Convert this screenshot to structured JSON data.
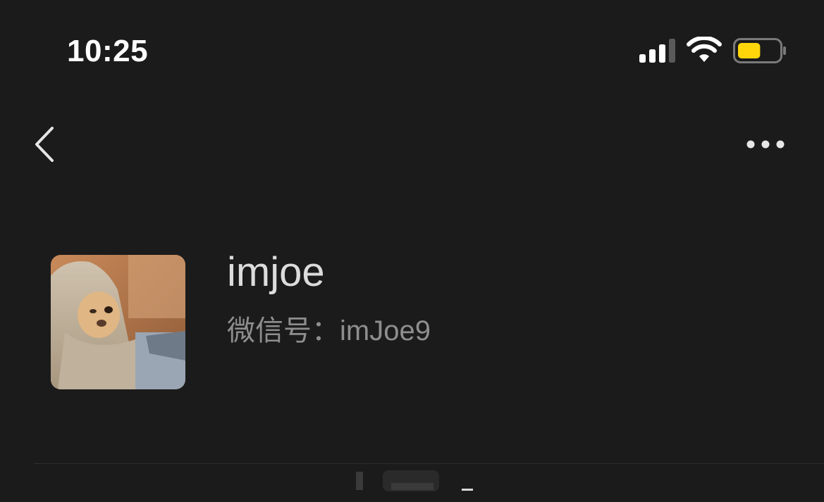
{
  "status_bar": {
    "time": "10:25",
    "signal_icon": "cellular-signal-icon",
    "wifi_icon": "wifi-icon",
    "battery_icon": "battery-icon",
    "battery_level": 0.55,
    "battery_color": "#ffd60a"
  },
  "nav": {
    "back_icon": "chevron-left-icon",
    "more_icon": "more-dots-icon"
  },
  "profile": {
    "nickname": "imjoe",
    "wechat_id_label": "微信号：",
    "wechat_id": "imJoe9",
    "avatar_icon": "cat-photo-avatar"
  },
  "colors": {
    "background": "#1b1b1b",
    "primary_text": "#dcdcdc",
    "secondary_text": "#8e8e8e"
  }
}
